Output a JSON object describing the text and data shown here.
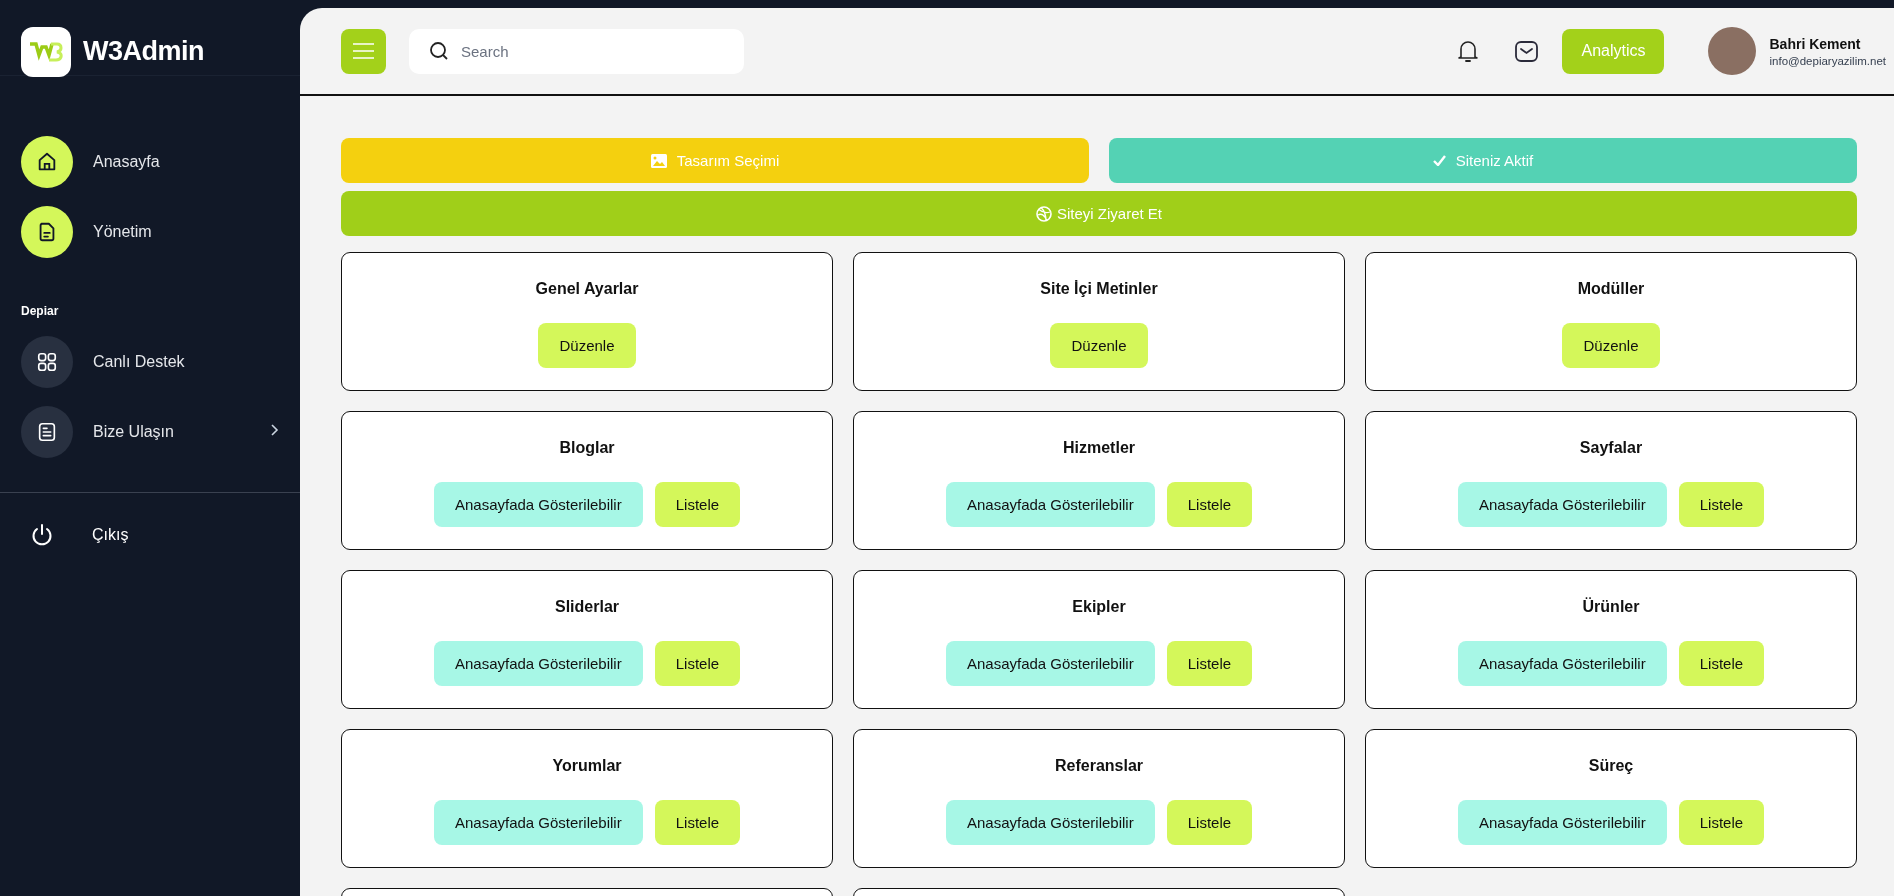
{
  "sidebar": {
    "brand": "W3Admin",
    "items": [
      {
        "label": "Anasayfa",
        "kind": "home",
        "highlighted": true,
        "has_submenu": false
      },
      {
        "label": "Yönetim",
        "kind": "document",
        "highlighted": true,
        "has_submenu": false
      }
    ],
    "section_title": "Depiar",
    "section_items": [
      {
        "label": "Canlı Destek",
        "kind": "grid",
        "highlighted": false,
        "has_submenu": false
      },
      {
        "label": "Bize Ulaşın",
        "kind": "list",
        "highlighted": false,
        "has_submenu": true
      }
    ],
    "logout": "Çıkış"
  },
  "header": {
    "search": {
      "placeholder": "Search"
    },
    "analytics_button": "Analytics",
    "user": {
      "name": "Bahri Kement",
      "email": "info@depiaryazilim.net"
    }
  },
  "actions": [
    {
      "label": "Tasarım Seçimi",
      "kind": "design"
    },
    {
      "label": "Siteniz Aktif",
      "kind": "active"
    },
    {
      "label": "Siteyi Ziyaret Et",
      "kind": "visit"
    }
  ],
  "cards": [
    {
      "kind": "edit",
      "title": "Genel Ayarlar",
      "buttons": [
        "Düzenle"
      ]
    },
    {
      "kind": "edit",
      "title": "Site İçi Metinler",
      "buttons": [
        "Düzenle"
      ]
    },
    {
      "kind": "edit",
      "title": "Modüller",
      "buttons": [
        "Düzenle"
      ]
    },
    {
      "kind": "list",
      "title": "Bloglar",
      "buttons": [
        "Anasayfada Gösterilebilir",
        "Listele"
      ]
    },
    {
      "kind": "list",
      "title": "Hizmetler",
      "buttons": [
        "Anasayfada Gösterilebilir",
        "Listele"
      ]
    },
    {
      "kind": "list",
      "title": "Sayfalar",
      "buttons": [
        "Anasayfada Gösterilebilir",
        "Listele"
      ]
    },
    {
      "kind": "list",
      "title": "Sliderlar",
      "buttons": [
        "Anasayfada Gösterilebilir",
        "Listele"
      ]
    },
    {
      "kind": "list",
      "title": "Ekipler",
      "buttons": [
        "Anasayfada Gösterilebilir",
        "Listele"
      ]
    },
    {
      "kind": "list",
      "title": "Ürünler",
      "buttons": [
        "Anasayfada Gösterilebilir",
        "Listele"
      ]
    },
    {
      "kind": "list",
      "title": "Yorumlar",
      "buttons": [
        "Anasayfada Gösterilebilir",
        "Listele"
      ]
    },
    {
      "kind": "list",
      "title": "Referanslar",
      "buttons": [
        "Anasayfada Gösterilebilir",
        "Listele"
      ]
    },
    {
      "kind": "list",
      "title": "Süreç",
      "buttons": [
        "Anasayfada Gösterilebilir",
        "Listele"
      ]
    },
    {
      "kind": "cut_off"
    },
    {
      "kind": "cut_off"
    }
  ]
}
